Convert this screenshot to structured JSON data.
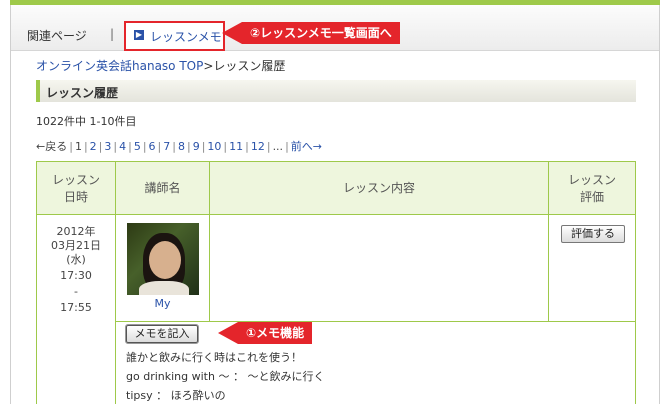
{
  "tabs": {
    "related": "関連ページ",
    "separator": "|",
    "memo": "レッスンメモ"
  },
  "callouts": {
    "memo_list": "②レッスンメモ一覧画面へ",
    "memo_feature": "①メモ機能"
  },
  "breadcrumb": {
    "home": "オンライン英会話hanaso TOP",
    "separator": ">",
    "current": "レッスン履歴"
  },
  "section": {
    "title": "レッスン履歴"
  },
  "result_count": "1022件中 1-10件目",
  "pager": {
    "prev": "←戻る",
    "pages": [
      "1",
      "2",
      "3",
      "4",
      "5",
      "6",
      "7",
      "8",
      "9",
      "10",
      "11",
      "12"
    ],
    "ellipsis": "...",
    "next": "前へ→"
  },
  "table": {
    "headers": {
      "datetime_line1": "レッスン",
      "datetime_line2": "日時",
      "teacher": "講師名",
      "content": "レッスン内容",
      "rating_line1": "レッスン",
      "rating_line2": "評価"
    },
    "row": {
      "date_lines": [
        "2012年",
        "03月21日",
        "(水)",
        "17:30",
        "-",
        "17:55"
      ],
      "teacher_name": "My",
      "rate_button": "評価する",
      "memo_button": "メモを記入",
      "memo_lines": [
        "誰かと飲みに行く時はこれを使う！",
        "go drinking with ～ ： ～と飲みに行く",
        "tipsy ： ほろ酔いの"
      ]
    }
  },
  "colors": {
    "accent_green": "#9ec94a",
    "link_blue": "#2a52a8",
    "annotation_red": "#e4252b"
  }
}
